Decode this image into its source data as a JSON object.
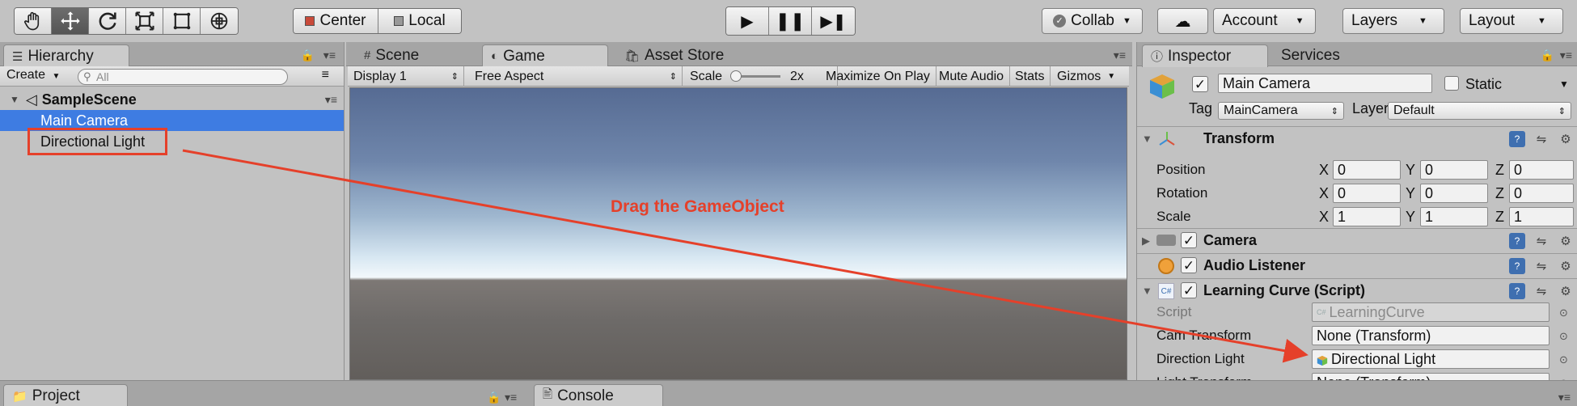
{
  "toolbar": {
    "tools": [
      {
        "name": "hand-tool",
        "icon": "hand-icon"
      },
      {
        "name": "move-tool",
        "icon": "move-icon",
        "active": true
      },
      {
        "name": "rotate-tool",
        "icon": "rotate-icon"
      },
      {
        "name": "scale-tool",
        "icon": "scale-icon"
      },
      {
        "name": "rect-tool",
        "icon": "rect-icon"
      },
      {
        "name": "transform-tool",
        "icon": "transform-icon"
      }
    ],
    "pivot_label": "Center",
    "space_label": "Local",
    "collab_label": "Collab",
    "account_label": "Account",
    "layers_label": "Layers",
    "layout_label": "Layout"
  },
  "hierarchy": {
    "tab_label": "Hierarchy",
    "create_label": "Create",
    "search_placeholder": "All",
    "scene_name": "SampleScene",
    "items": [
      {
        "label": "Main Camera",
        "selected": true
      },
      {
        "label": "Directional Light",
        "selected": false
      }
    ]
  },
  "center_tabs": {
    "scene_label": "Scene",
    "game_label": "Game",
    "asset_store_label": "Asset Store"
  },
  "game_toolbar": {
    "display": "Display 1",
    "aspect": "Free Aspect",
    "scale_label": "Scale",
    "scale_value": "2x",
    "maximize": "Maximize On Play",
    "mute": "Mute Audio",
    "stats": "Stats",
    "gizmos": "Gizmos"
  },
  "annotation": {
    "label": "Drag the GameObject",
    "color": "#e5402a"
  },
  "inspector": {
    "tab_label": "Inspector",
    "services_label": "Services",
    "object_name": "Main Camera",
    "static_label": "Static",
    "tag_label": "Tag",
    "tag_value": "MainCamera",
    "layer_label": "Layer",
    "layer_value": "Default",
    "transform": {
      "title": "Transform",
      "rows": [
        {
          "label": "Position",
          "x": "0",
          "y": "0",
          "z": "0"
        },
        {
          "label": "Rotation",
          "x": "0",
          "y": "0",
          "z": "0"
        },
        {
          "label": "Scale",
          "x": "1",
          "y": "1",
          "z": "1"
        }
      ],
      "axis_x": "X",
      "axis_y": "Y",
      "axis_z": "Z"
    },
    "camera_title": "Camera",
    "audio_listener_title": "Audio Listener",
    "script_component": {
      "title": "Learning Curve (Script)",
      "script_label": "Script",
      "script_value": "LearningCurve",
      "fields": [
        {
          "label": "Cam Transform",
          "value": "None (Transform)"
        },
        {
          "label": "Direction Light",
          "value": "Directional Light"
        },
        {
          "label": "Light Transform",
          "value": "None (Transform)"
        }
      ]
    }
  },
  "bottom": {
    "project_label": "Project",
    "console_label": "Console"
  }
}
